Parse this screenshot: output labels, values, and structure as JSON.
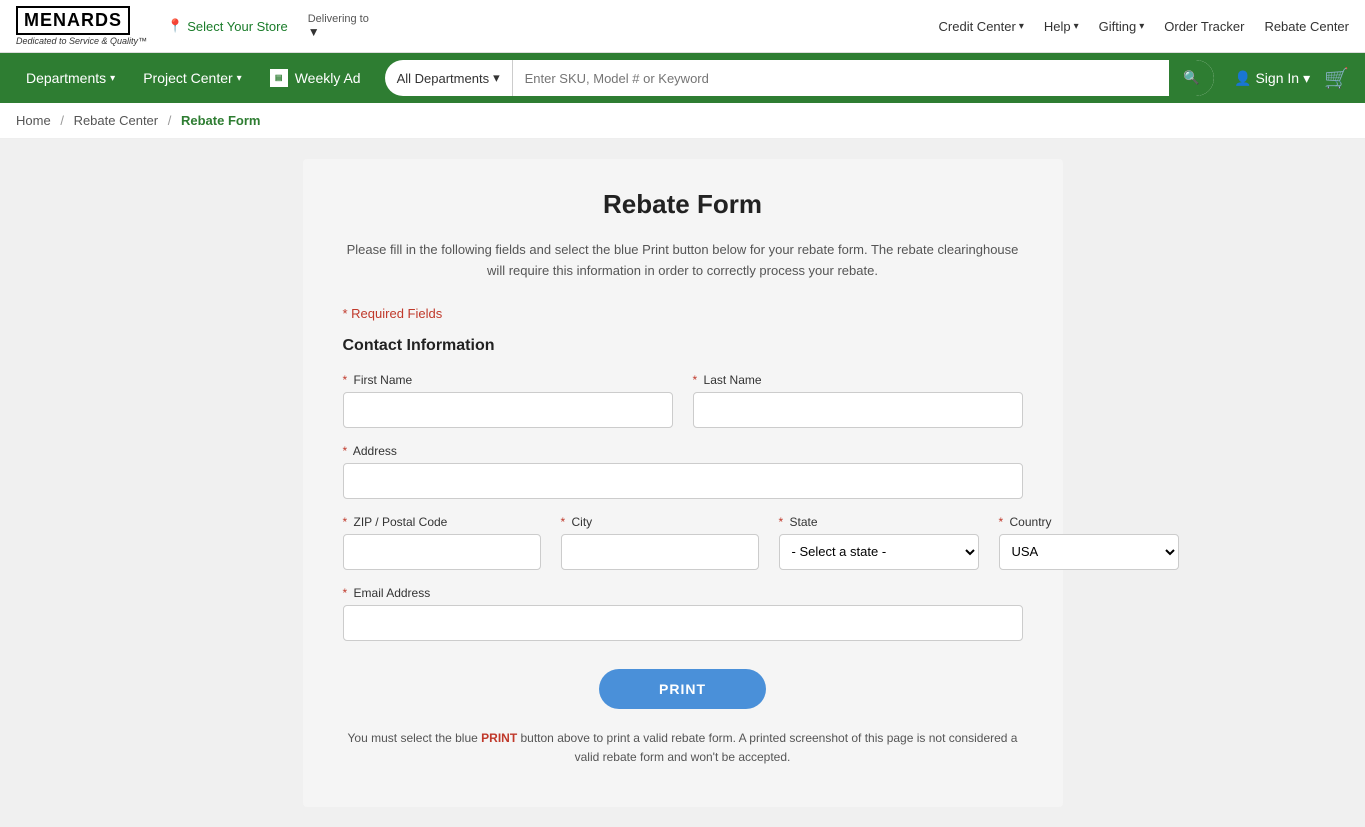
{
  "topbar": {
    "logo_text": "MENARDS",
    "logo_tagline": "Dedicated to Service & Quality™",
    "store_label": "Select Your Store",
    "delivering_to": "Delivering to",
    "delivering_chevron": "▼",
    "right_links": [
      {
        "label": "Credit Center",
        "has_chevron": true
      },
      {
        "label": "Help",
        "has_chevron": true
      },
      {
        "label": "Gifting",
        "has_chevron": true
      },
      {
        "label": "Order Tracker",
        "has_chevron": false
      },
      {
        "label": "Rebate Center",
        "has_chevron": false
      }
    ]
  },
  "nav": {
    "departments_label": "Departments",
    "project_center_label": "Project Center",
    "weekly_ad_label": "Weekly Ad",
    "search": {
      "category_label": "All Departments",
      "placeholder": "Enter SKU, Model # or Keyword"
    },
    "sign_in_label": "Sign In"
  },
  "breadcrumb": {
    "home": "Home",
    "rebate_center": "Rebate Center",
    "current": "Rebate Form"
  },
  "form": {
    "title": "Rebate Form",
    "description": "Please fill in the following fields and select the blue Print button below for your rebate form. The rebate clearinghouse will require this information in order to correctly process your rebate.",
    "required_note": "* Required Fields",
    "section_title": "Contact Information",
    "fields": {
      "first_name_label": "First Name",
      "last_name_label": "Last Name",
      "address_label": "Address",
      "zip_label": "ZIP / Postal Code",
      "city_label": "City",
      "state_label": "State",
      "state_placeholder": "- Select a state -",
      "country_label": "Country",
      "country_default": "USA",
      "email_label": "Email Address"
    },
    "print_button": "PRINT",
    "print_note": "You must select the blue PRINT button above to print a valid rebate form. A printed screenshot of this page is not considered a valid rebate form and won't be accepted.",
    "print_note_highlight": "PRINT"
  },
  "icons": {
    "search": "🔍",
    "location_pin": "📍",
    "user": "👤",
    "cart": "🛒",
    "chevron_down": "▾"
  }
}
